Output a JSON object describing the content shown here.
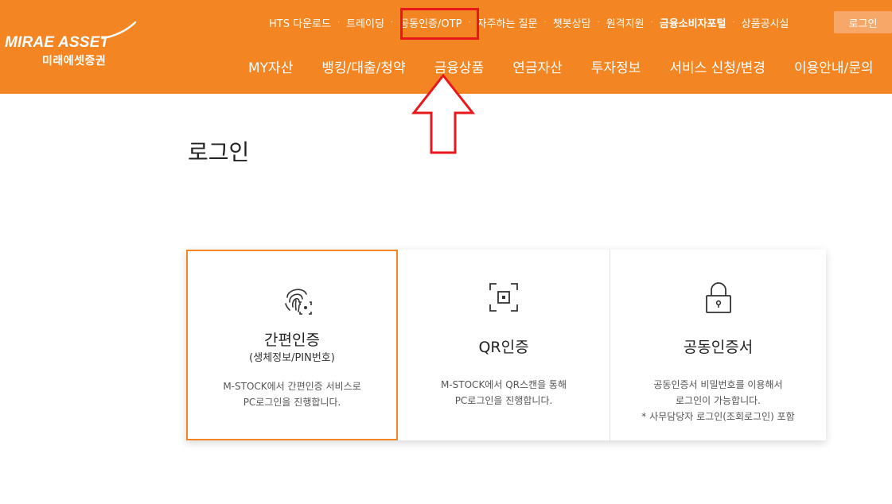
{
  "logo": {
    "english": "MIRAE ASSET",
    "korean": "미래에셋증권"
  },
  "utility_nav": [
    {
      "label": "HTS 다운로드"
    },
    {
      "label": "트레이딩"
    },
    {
      "label": "공동인증/OTP"
    },
    {
      "label": "자주하는 질문"
    },
    {
      "label": "챗봇상담"
    },
    {
      "label": "원격지원"
    },
    {
      "label": "금융소비자포털"
    },
    {
      "label": "상품공시실"
    }
  ],
  "login_button": "로그인",
  "main_nav": [
    {
      "label": "MY자산"
    },
    {
      "label": "뱅킹/대출/청약"
    },
    {
      "label": "금융상품"
    },
    {
      "label": "연금자산"
    },
    {
      "label": "투자정보"
    },
    {
      "label": "서비스 신청/변경"
    },
    {
      "label": "이용안내/문의"
    }
  ],
  "page_title": "로그인",
  "cards": [
    {
      "title": "간편인증",
      "subtitle": "(생체정보/PIN번호)",
      "desc1": "M-STOCK에서 간편인증 서비스로",
      "desc2": "PC로그인을 진행합니다."
    },
    {
      "title": "QR인증",
      "desc1": "M-STOCK에서 QR스캔을 통해",
      "desc2": "PC로그인을 진행합니다."
    },
    {
      "title": "공동인증서",
      "desc1": "공동인증서 비밀번호를 이용해서",
      "desc2": "로그인이 가능합니다.",
      "desc3": "* 사무담당자 로그인(조회로그인) 포함"
    }
  ],
  "colors": {
    "brand_orange": "#f38522",
    "highlight_red": "#e8171c"
  },
  "icons": [
    "fingerprint-icon",
    "qr-scan-icon",
    "padlock-icon",
    "up-arrow-annotation"
  ]
}
